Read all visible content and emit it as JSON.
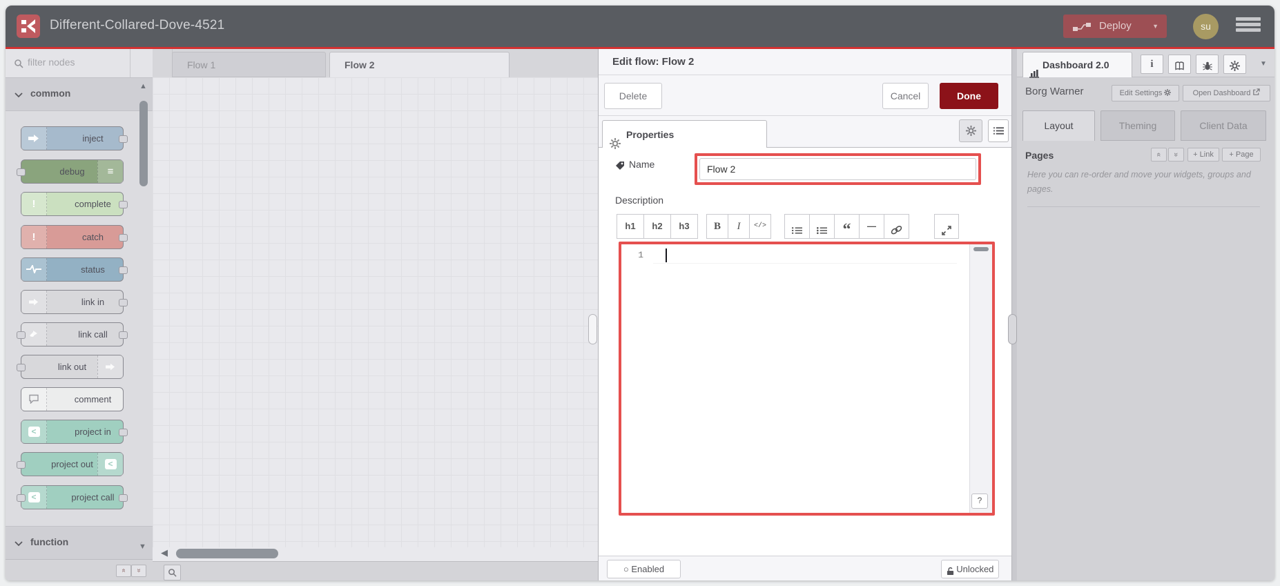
{
  "header": {
    "title": "Different-Collared-Dove-4521",
    "deploy_label": "Deploy",
    "avatar_initials": "su"
  },
  "palette": {
    "filter_placeholder": "filter nodes",
    "category_common": "common",
    "category_function": "function",
    "nodes": [
      {
        "label": "inject",
        "color": "#a6bacc"
      },
      {
        "label": "debug",
        "color": "#8aa47d"
      },
      {
        "label": "complete",
        "color": "#cbe0c0"
      },
      {
        "label": "catch",
        "color": "#d89b97"
      },
      {
        "label": "status",
        "color": "#93b1c4"
      },
      {
        "label": "link in",
        "color": "#d8d8db"
      },
      {
        "label": "link call",
        "color": "#d8d8db"
      },
      {
        "label": "link out",
        "color": "#d8d8db"
      },
      {
        "label": "comment",
        "color": "#eceded"
      },
      {
        "label": "project in",
        "color": "#a0cfc0"
      },
      {
        "label": "project out",
        "color": "#a0cfc0"
      },
      {
        "label": "project call",
        "color": "#a0cfc0"
      }
    ]
  },
  "canvas": {
    "tabs": [
      {
        "label": "Flow 1",
        "active": false
      },
      {
        "label": "Flow 2",
        "active": true
      }
    ]
  },
  "tray": {
    "title": "Edit flow: Flow 2",
    "delete_label": "Delete",
    "cancel_label": "Cancel",
    "done_label": "Done",
    "properties_tab": "Properties",
    "name_label": "Name",
    "name_value": "Flow 2",
    "description_label": "Description",
    "toolbar": {
      "h1": "h1",
      "h2": "h2",
      "h3": "h3",
      "bold": "B",
      "italic": "I",
      "code": "</>"
    },
    "editor": {
      "line1": "1"
    },
    "enabled_label": "Enabled",
    "unlocked_label": "Unlocked"
  },
  "sidebar": {
    "dashboard_tab": "Dashboard 2.0",
    "project_name": "Borg Warner",
    "edit_settings_label": "Edit Settings",
    "open_dashboard_label": "Open Dashboard",
    "tabs": [
      {
        "label": "Layout",
        "active": true
      },
      {
        "label": "Theming",
        "active": false
      },
      {
        "label": "Client Data",
        "active": false
      }
    ],
    "pages_label": "Pages",
    "add_link_label": "+ Link",
    "add_page_label": "+ Page",
    "help_text": "Here you can re-order and move your widgets, groups and pages."
  },
  "icons": {
    "info": "i",
    "caret_down": "▼",
    "tri_up": "▲",
    "tri_down": "▼",
    "tri_left": "◀",
    "dbl_chev": "»",
    "dbl_chev_up": "«",
    "circle": "○",
    "quote": "“",
    "hr": "—",
    "lines": "≡",
    "bang": "!",
    "chev_cut": "<",
    "question": "?"
  },
  "colors": {
    "header_bg": "#595c61",
    "accent_red_line": "#d23232",
    "deploy_bg": "#9d4f54",
    "done_bg": "#8c1219",
    "annotation_red": "#e5504f",
    "avatar_bg": "#a89a63"
  }
}
